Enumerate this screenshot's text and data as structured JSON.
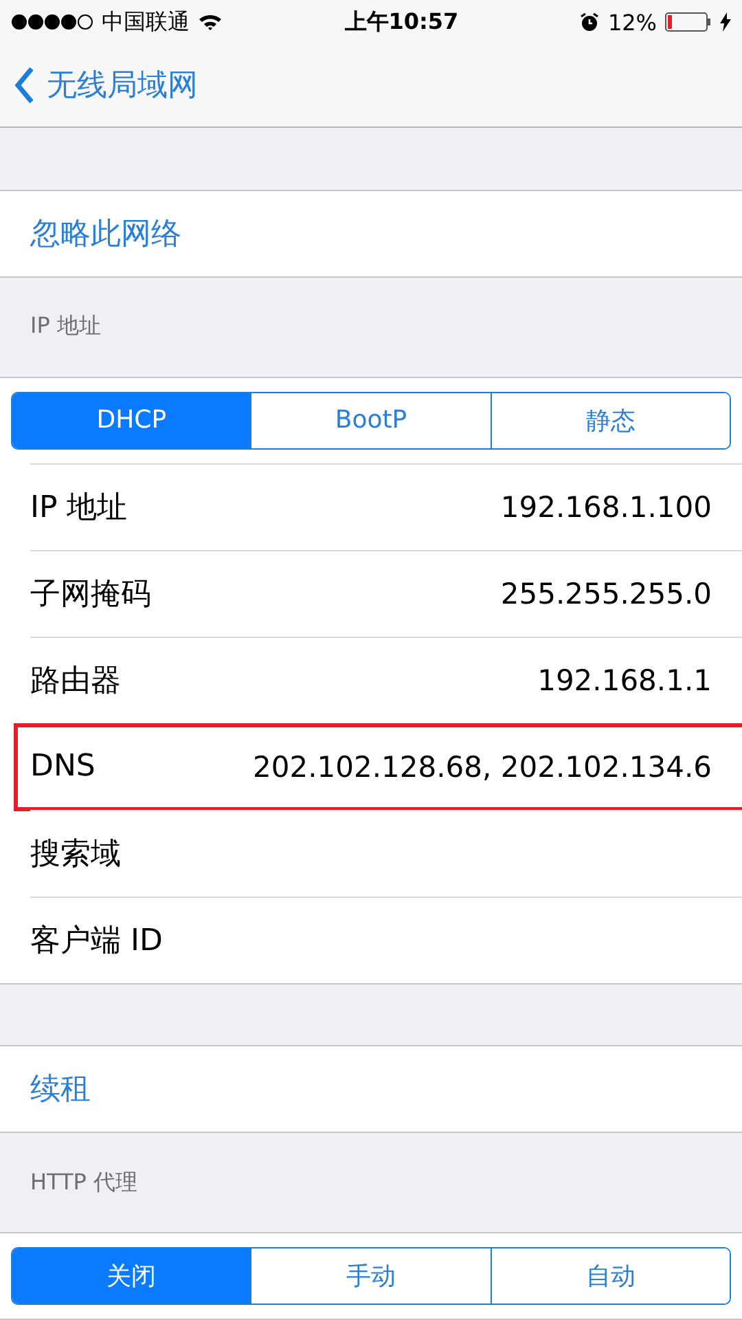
{
  "status_bar": {
    "carrier": "中国联通",
    "time": "上午10:57",
    "battery": "12%"
  },
  "nav": {
    "back": "无线局域网"
  },
  "ignore": {
    "label": "忽略此网络"
  },
  "ip_section": {
    "header": "IP 地址",
    "modes": [
      {
        "label": "DHCP",
        "selected": true
      },
      {
        "label": "BootP",
        "selected": false
      },
      {
        "label": "静态",
        "selected": false
      }
    ],
    "rows": [
      {
        "label": "IP 地址",
        "value": "192.168.1.100",
        "highlighted": false
      },
      {
        "label": "子网掩码",
        "value": "255.255.255.0",
        "highlighted": false
      },
      {
        "label": "路由器",
        "value": "192.168.1.1",
        "highlighted": false
      },
      {
        "label": "DNS",
        "value": "202.102.128.68, 202.102.134.6",
        "highlighted": true
      },
      {
        "label": "搜索域",
        "highlighted": false
      },
      {
        "label": "客户端 ID",
        "highlighted": false
      }
    ]
  },
  "renew": {
    "label": "续租"
  },
  "proxy_section": {
    "header": "HTTP 代理",
    "modes": [
      {
        "label": "关闭",
        "selected": true
      },
      {
        "label": "手动",
        "selected": false
      },
      {
        "label": "自动",
        "selected": false
      }
    ]
  }
}
